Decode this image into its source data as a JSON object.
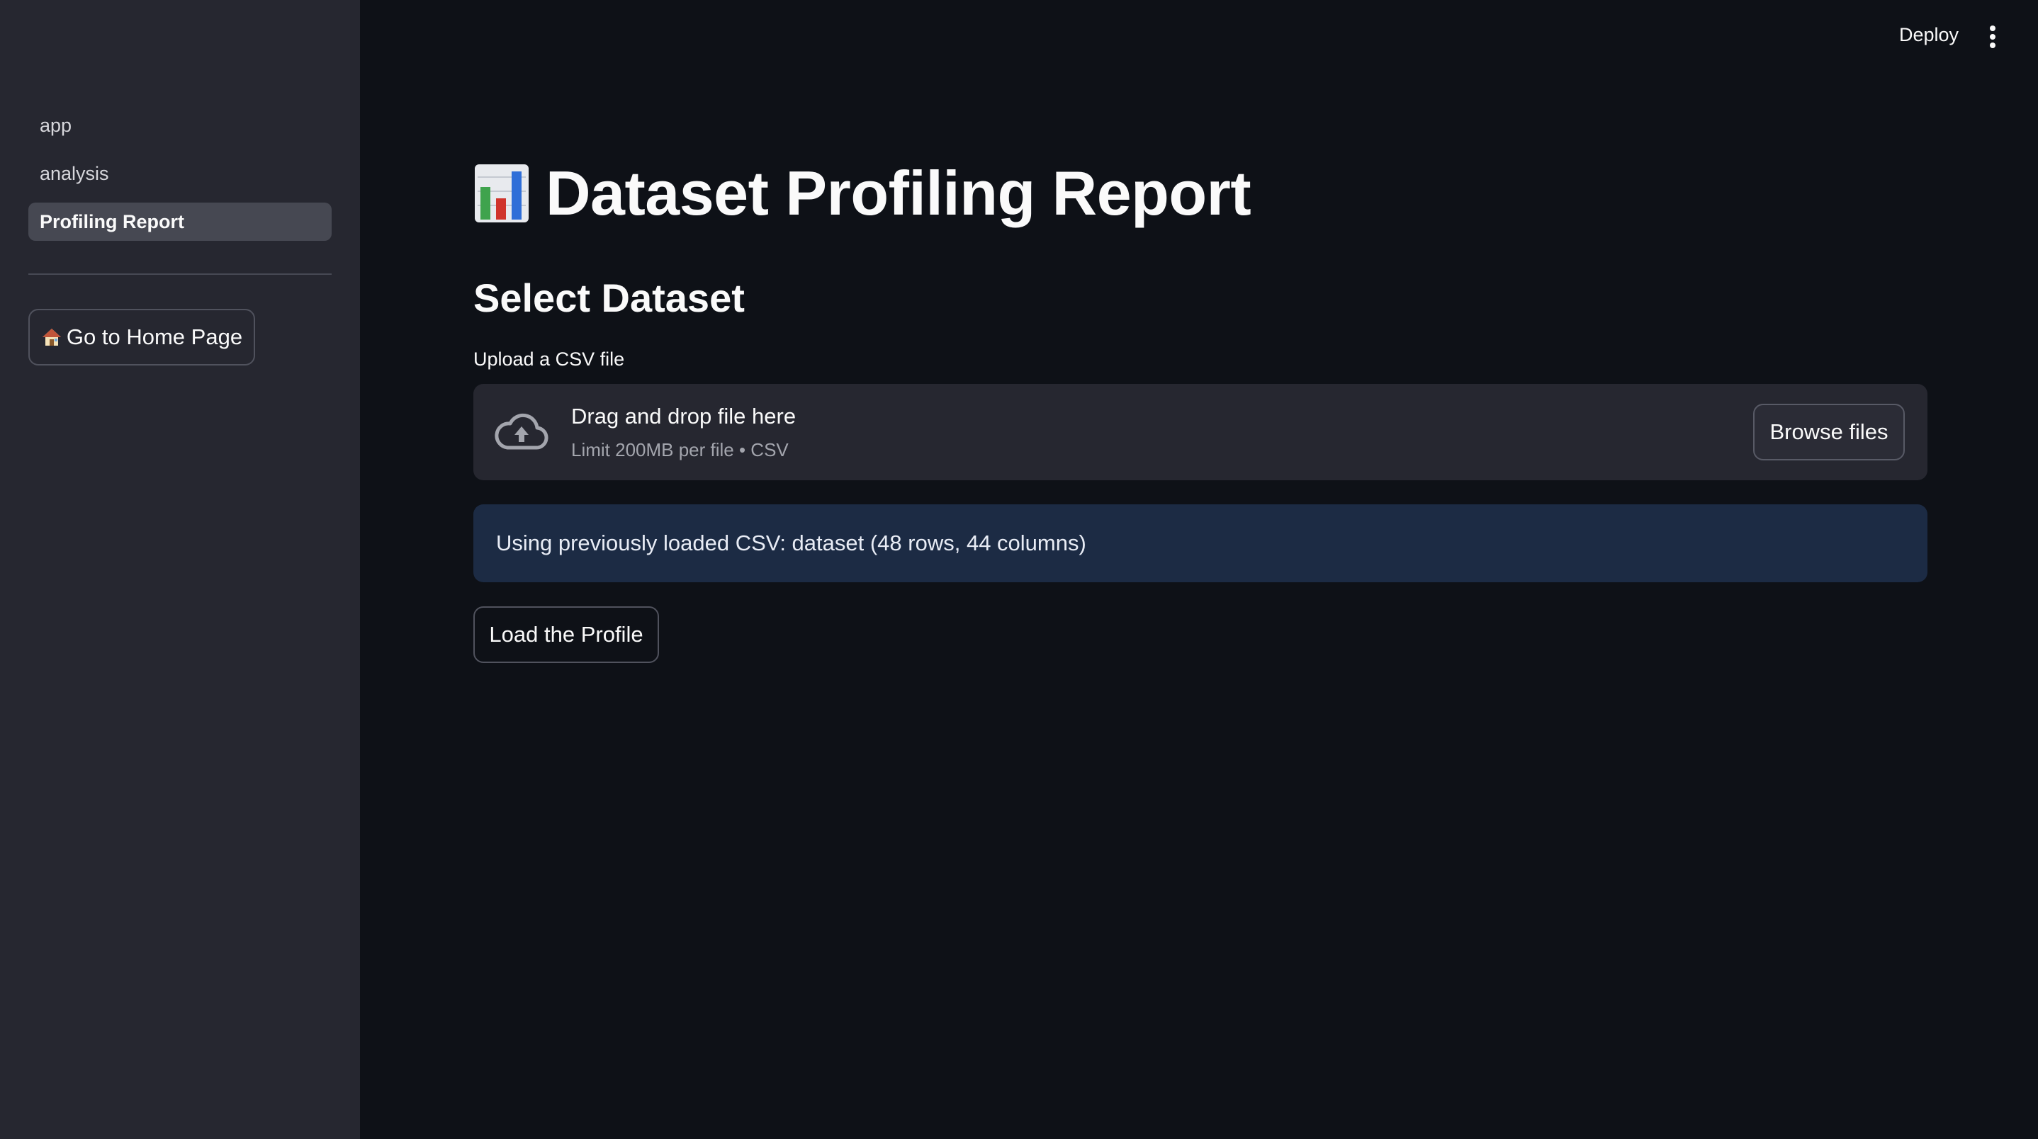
{
  "sidebar": {
    "nav_items": [
      {
        "label": "app",
        "active": false
      },
      {
        "label": "analysis",
        "active": false
      },
      {
        "label": "Profiling Report",
        "active": true
      }
    ],
    "home_button": {
      "label": "Go to Home Page",
      "icon": "house-icon"
    }
  },
  "header": {
    "deploy_label": "Deploy",
    "menu_icon": "vertical-dots-icon"
  },
  "main": {
    "title": "Dataset Profiling Report",
    "title_icon": "bar-chart-icon",
    "subheader": "Select Dataset",
    "uploader": {
      "label": "Upload a CSV file",
      "drop_text": "Drag and drop file here",
      "limit_text": "Limit 200MB per file • CSV",
      "browse_label": "Browse files",
      "icon": "cloud-upload-icon"
    },
    "info_message": "Using previously loaded CSV: dataset (48 rows, 44 columns)",
    "load_button_label": "Load the Profile"
  },
  "colors": {
    "background": "#0e1117",
    "sidebar": "#262730",
    "info_background": "#1c2b44"
  }
}
